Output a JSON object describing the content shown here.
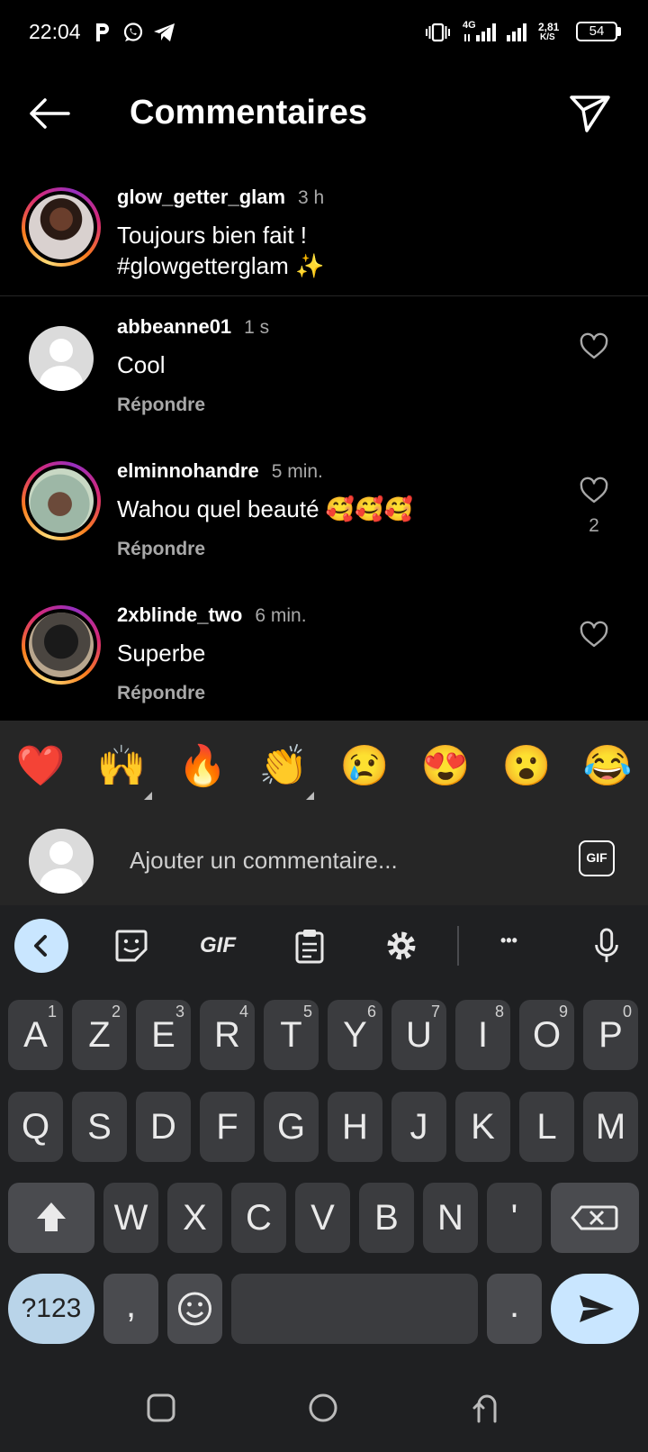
{
  "status": {
    "time": "22:04",
    "network_4g": "4G",
    "speed_value": "2,81",
    "speed_unit": "K/S",
    "battery": "54"
  },
  "header": {
    "title": "Commentaires"
  },
  "caption": {
    "username": "glow_getter_glam",
    "time": "3 h",
    "line1": "Toujours bien fait !",
    "line2": "#glowgetterglam ✨"
  },
  "comments": [
    {
      "username": "abbeanne01",
      "time": "1 s",
      "text": "Cool",
      "reply": "Répondre",
      "likes": ""
    },
    {
      "username": "elminnohandre",
      "time": "5 min.",
      "text": "Wahou quel beauté 🥰🥰🥰",
      "reply": "Répondre",
      "likes": "2"
    },
    {
      "username": "2xblinde_two",
      "time": "6 min.",
      "text": "Superbe",
      "reply": "Répondre",
      "likes": ""
    }
  ],
  "emoji_bar": [
    "❤️",
    "🙌",
    "🔥",
    "👏",
    "😢",
    "😍",
    "😮",
    "😂"
  ],
  "input": {
    "placeholder": "Ajouter un commentaire...",
    "gif_label": "GIF"
  },
  "keyboard": {
    "toolbar_gif": "GIF",
    "toolbar_more": "•••",
    "row1": [
      {
        "k": "A",
        "h": "1"
      },
      {
        "k": "Z",
        "h": "2"
      },
      {
        "k": "E",
        "h": "3"
      },
      {
        "k": "R",
        "h": "4"
      },
      {
        "k": "T",
        "h": "5"
      },
      {
        "k": "Y",
        "h": "6"
      },
      {
        "k": "U",
        "h": "7"
      },
      {
        "k": "I",
        "h": "8"
      },
      {
        "k": "O",
        "h": "9"
      },
      {
        "k": "P",
        "h": "0"
      }
    ],
    "row2": [
      "Q",
      "S",
      "D",
      "F",
      "G",
      "H",
      "J",
      "K",
      "L",
      "M"
    ],
    "row3": [
      "W",
      "X",
      "C",
      "V",
      "B",
      "N",
      "'"
    ],
    "symbols_key": "?123",
    "comma_key": ",",
    "period_key": "."
  },
  "colors": {
    "background": "#000000",
    "secondary_text": "#a8a8a8",
    "panel": "#262626",
    "keyboard_bg": "#1f2022",
    "accent_key": "#c9e6ff"
  }
}
